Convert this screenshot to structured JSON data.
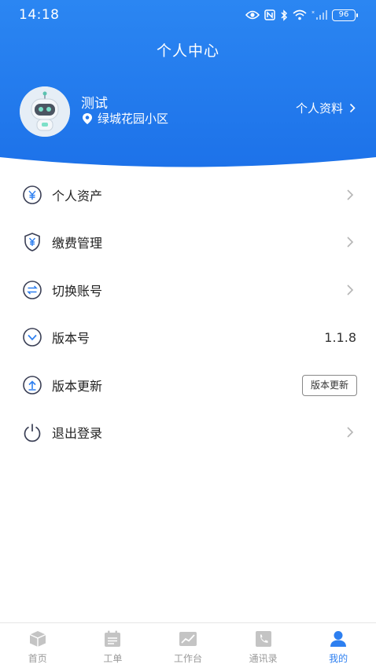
{
  "status_bar": {
    "time": "14:18",
    "battery": "96"
  },
  "header": {
    "title": "个人中心",
    "user_name": "测试",
    "community": "绿城花园小区",
    "profile_link": "个人资料"
  },
  "menu": {
    "items": [
      {
        "label": "个人资产",
        "icon": "yuan-coin-icon"
      },
      {
        "label": "缴费管理",
        "icon": "payment-shield-icon"
      },
      {
        "label": "切换账号",
        "icon": "switch-arrows-icon"
      },
      {
        "label": "版本号",
        "icon": "chevron-circle-icon",
        "value": "1.1.8"
      },
      {
        "label": "版本更新",
        "icon": "upload-circle-icon",
        "button": "版本更新"
      },
      {
        "label": "退出登录",
        "icon": "power-icon"
      }
    ]
  },
  "bottom_nav": {
    "items": [
      {
        "label": "首页",
        "icon": "box-icon"
      },
      {
        "label": "工单",
        "icon": "calendar-list-icon"
      },
      {
        "label": "工作台",
        "icon": "chart-icon"
      },
      {
        "label": "通讯录",
        "icon": "phone-book-icon"
      },
      {
        "label": "我的",
        "icon": "user-icon",
        "active": true
      }
    ]
  },
  "colors": {
    "primary": "#2d7ff0",
    "header_top": "#2b86f2",
    "header_bottom": "#1c6fe8"
  }
}
